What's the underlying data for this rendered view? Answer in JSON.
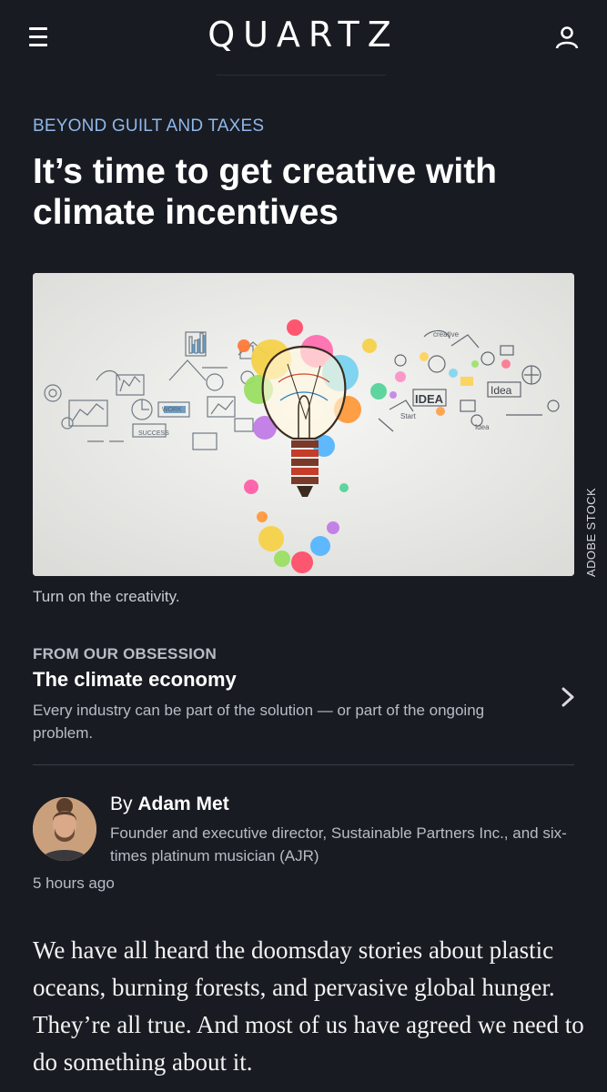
{
  "header": {
    "logo": "QUARTZ",
    "menu_icon": "hamburger-menu-icon",
    "user_icon": "user-account-icon"
  },
  "article": {
    "kicker": "BEYOND GUILT AND TAXES",
    "headline": "It’s time to get creative with climate incentives",
    "image": {
      "credit": "ADOBE STOCK",
      "caption": "Turn on the creativity.",
      "doodle_words": [
        "creative",
        "IDEA",
        "Idea",
        "WORK",
        "SUCCESS",
        "Start",
        "Idea"
      ]
    },
    "obsession": {
      "label": "FROM OUR OBSESSION",
      "title": "The climate economy",
      "description": "Every industry can be part of the solution — or part of the ongoing problem.",
      "chevron_icon": "chevron-right-icon"
    },
    "byline": {
      "prefix": "By",
      "author": "Adam Met",
      "bio": "Founder and executive director, Sustainable Partners Inc., and six-times platinum musician (AJR)",
      "timestamp": "5 hours ago"
    },
    "body": "We have all heard the doomsday stories about plastic oceans, burning forests, and pervasive global hunger. They’re all true. And most of us have  agreed we need to do something about it."
  },
  "colors": {
    "background": "#191b22",
    "kicker": "#8fb8ea",
    "muted_text": "#b9bcc4"
  }
}
